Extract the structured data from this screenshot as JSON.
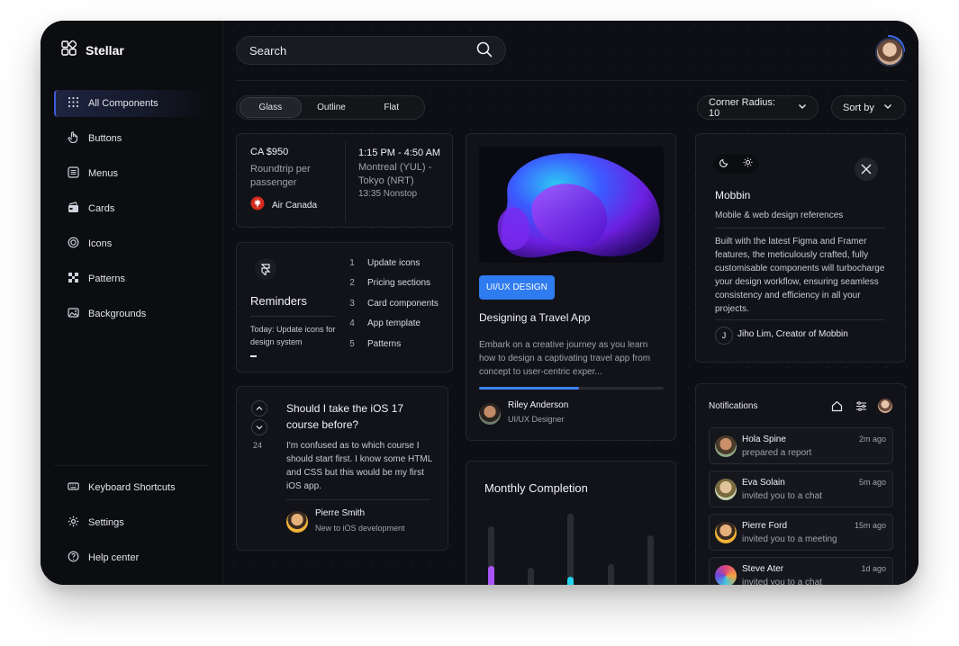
{
  "app": {
    "name": "Stellar"
  },
  "sidebar": {
    "items": [
      {
        "label": "All Components",
        "icon": "grid-icon"
      },
      {
        "label": "Buttons",
        "icon": "pointer-hand-icon"
      },
      {
        "label": "Menus",
        "icon": "menu-list-icon"
      },
      {
        "label": "Cards",
        "icon": "cards-icon"
      },
      {
        "label": "Icons",
        "icon": "target-icon"
      },
      {
        "label": "Patterns",
        "icon": "pattern-icon"
      },
      {
        "label": "Backgrounds",
        "icon": "image-icon"
      }
    ],
    "bottom_items": [
      {
        "label": "Keyboard Shortcuts",
        "icon": "keyboard-icon"
      },
      {
        "label": "Settings",
        "icon": "gear-icon"
      },
      {
        "label": "Help center",
        "icon": "help-circle-icon"
      }
    ]
  },
  "search": {
    "placeholder": "Search"
  },
  "style_tabs": {
    "items": [
      "Glass",
      "Outline",
      "Flat"
    ],
    "active": "Glass"
  },
  "corner_radius": {
    "label": "Corner Radius: 10"
  },
  "sort": {
    "label": "Sort by"
  },
  "flight": {
    "price": "CA $950",
    "fare_type": "Roundtrip per passenger",
    "airline": "Air Canada",
    "time": "1:15 PM - 4:50 AM",
    "route": "Montreal (YUL) - Tokyo (NRT)",
    "duration": "13:35 Nonstop"
  },
  "reminders": {
    "title": "Reminders",
    "today": "Today: Update icons for design system",
    "items": [
      {
        "num": "1",
        "text": "Update icons"
      },
      {
        "num": "2",
        "text": "Pricing sections"
      },
      {
        "num": "3",
        "text": "Card components"
      },
      {
        "num": "4",
        "text": "App template"
      },
      {
        "num": "5",
        "text": "Patterns"
      }
    ]
  },
  "question": {
    "votes": "24",
    "title": "Should I take the iOS 17 course before?",
    "body": "I'm confused as to which course I should start first. I know some HTML and CSS but this would be my first iOS app.",
    "author": "Pierre Smith",
    "author_role": "New to iOS development"
  },
  "travel": {
    "tag": "UI/UX DESIGN",
    "title": "Designing a Travel App",
    "description": "Embark on a creative journey as you learn how to design a captivating travel app from concept to user-centric exper...",
    "progress": 0.54,
    "author": "Riley Anderson",
    "author_role": "UI/UX Designer"
  },
  "monthly": {
    "title": "Monthly Completion",
    "accent_colors": [
      "#a855f7",
      "#22d3ee"
    ]
  },
  "mobbin": {
    "title": "Mobbin",
    "subtitle": "Mobile & web design references",
    "body": "Built with the latest Figma and Framer features, the meticulously crafted, fully customisable components will turbocharge your design workflow, ensuring seamless consistency and efficiency in all your projects.",
    "author_initial": "J",
    "author": "Jiho Lim, Creator of Mobbin"
  },
  "notifications": {
    "title": "Notifications",
    "items": [
      {
        "name": "Hola Spine",
        "desc": "prepared a report",
        "time": "2m ago"
      },
      {
        "name": "Eva Solain",
        "desc": "invited you to a chat",
        "time": "5m ago"
      },
      {
        "name": "Pierre Ford",
        "desc": "invited you to a meeting",
        "time": "15m ago"
      },
      {
        "name": "Steve Ater",
        "desc": "invited you to a chat",
        "time": "1d ago"
      }
    ]
  },
  "colors": {
    "background": "#0d0e13",
    "accent_blue": "#2f7bf0",
    "nav_active": "#3e5bd6",
    "airline_red": "#d52b1e"
  }
}
